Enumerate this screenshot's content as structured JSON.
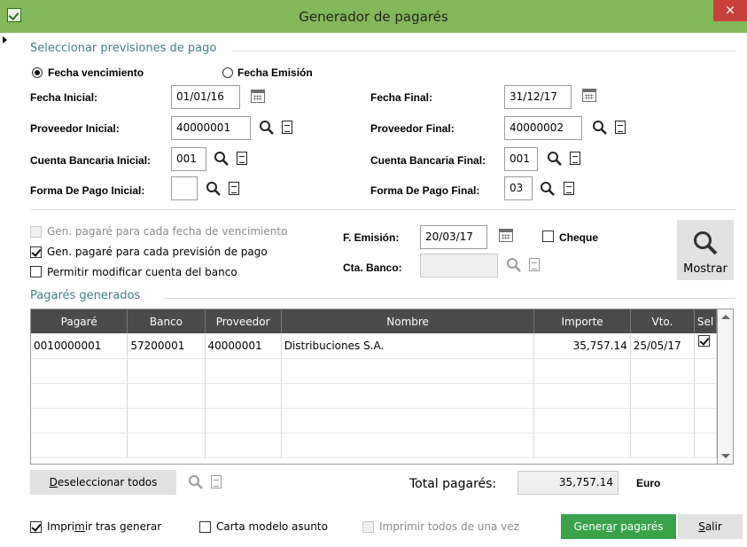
{
  "window": {
    "title": "Generador de pagarés",
    "close": "×"
  },
  "section1": {
    "title": "Seleccionar previsiones de pago"
  },
  "radios": {
    "vencimiento": "Fecha vencimiento",
    "emision": "Fecha Emisión",
    "selected": "vencimiento"
  },
  "fields": {
    "fecha_inicial": {
      "label": "Fecha Inicial:",
      "value": "01/01/16"
    },
    "fecha_final": {
      "label": "Fecha Final:",
      "value": "31/12/17"
    },
    "proveedor_inicial": {
      "label": "Proveedor Inicial:",
      "value": "40000001"
    },
    "proveedor_final": {
      "label": "Proveedor Final:",
      "value": "40000002"
    },
    "cuenta_inicial": {
      "label": "Cuenta Bancaria Inicial:",
      "value": "001"
    },
    "cuenta_final": {
      "label": "Cuenta Bancaria Final:",
      "value": "001"
    },
    "forma_inicial": {
      "label": "Forma De Pago Inicial:",
      "value": ""
    },
    "forma_final": {
      "label": "Forma De Pago Final:",
      "value": "03"
    }
  },
  "options": {
    "gen_fecha": {
      "label": "Gen. pagaré para cada fecha de vencimiento",
      "checked": false,
      "disabled": true
    },
    "gen_prevision": {
      "label": "Gen. pagaré para cada previsión de pago",
      "checked": true
    },
    "permitir": {
      "label": "Permitir modificar cuenta del banco",
      "checked": false
    }
  },
  "emision": {
    "label": "F. Emisión:",
    "value": "20/03/17"
  },
  "cheque": {
    "label": "Cheque",
    "checked": false
  },
  "cta_banco": {
    "label": "Cta. Banco:",
    "value": ""
  },
  "mostrar_label": "Mostrar",
  "section2": {
    "title": "Pagarés generados"
  },
  "table": {
    "columns": [
      "Pagaré",
      "Banco",
      "Proveedor",
      "Nombre",
      "Importe",
      "Vto.",
      "Sel"
    ],
    "rows": [
      {
        "pagare": "0010000001",
        "banco": "57200001",
        "proveedor": "40000001",
        "nombre": "Distribuciones S.A.",
        "importe": "35,757.14",
        "vto": "25/05/17",
        "sel": true
      }
    ]
  },
  "deseleccionar": {
    "first": "D",
    "rest": "eseleccionar todos"
  },
  "total": {
    "label": "Total pagarés:",
    "value": "35,757.14",
    "currency": "Euro"
  },
  "footer": {
    "imprimir_tras": {
      "pre": "Impri",
      "u": "m",
      "post": "ir tras generar",
      "checked": true
    },
    "carta": {
      "label": "Carta modelo asunto",
      "checked": false
    },
    "imprimir_todos": {
      "label": "Imprimir todos de una vez",
      "checked": false,
      "disabled": true
    },
    "generar": {
      "pre": "Gener",
      "u": "a",
      "post": "r pagarés"
    },
    "salir": {
      "u": "S",
      "post": "alir"
    }
  },
  "colors": {
    "titlebar": "#83b85a",
    "accent_text": "#3f7f7f",
    "primary_button": "#3aa34a",
    "close": "#c7403c",
    "table_header": "#4a4a4a"
  }
}
